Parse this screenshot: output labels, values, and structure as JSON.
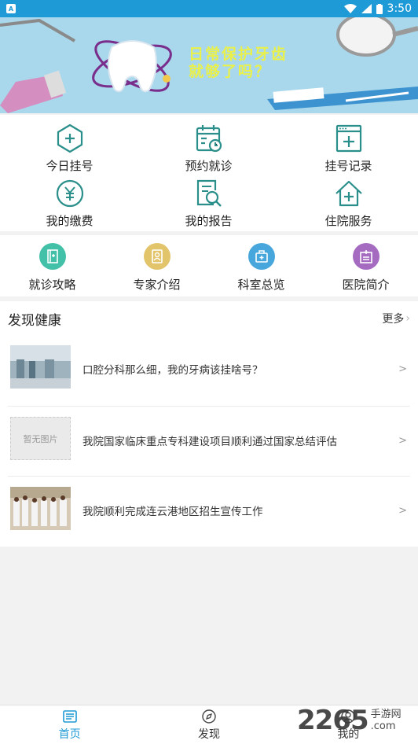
{
  "status_bar": {
    "time": "3:50",
    "app_icon": "A"
  },
  "banner": {
    "line1": "日常保护牙齿",
    "line2": "就够了吗？"
  },
  "main_grid": [
    {
      "label": "今日挂号",
      "icon": "plus-hex-icon"
    },
    {
      "label": "预约就诊",
      "icon": "calendar-clock-icon"
    },
    {
      "label": "挂号记录",
      "icon": "browser-plus-icon"
    },
    {
      "label": "我的缴费",
      "icon": "yuan-coin-icon"
    },
    {
      "label": "我的报告",
      "icon": "report-search-icon"
    },
    {
      "label": "住院服务",
      "icon": "house-plus-icon"
    }
  ],
  "secondary_grid": [
    {
      "label": "就诊攻略",
      "icon": "guide-book-icon",
      "color": "#43c0a8"
    },
    {
      "label": "专家介绍",
      "icon": "doctor-badge-icon",
      "color": "#e2c46a"
    },
    {
      "label": "科室总览",
      "icon": "medical-kit-icon",
      "color": "#47a7dc"
    },
    {
      "label": "医院简介",
      "icon": "hospital-icon",
      "color": "#a46bc0"
    }
  ],
  "discover": {
    "title": "发现健康",
    "more": "更多",
    "items": [
      {
        "title": "口腔分科那么细，我的牙病该挂啥号？",
        "thumb": "photo"
      },
      {
        "title": "我院国家临床重点专科建设项目顺利通过国家总结评估",
        "thumb": "placeholder",
        "placeholder_text": "暂无图片"
      },
      {
        "title": "我院顺利完成连云港地区招生宣传工作",
        "thumb": "photo"
      }
    ]
  },
  "bottom_nav": [
    {
      "label": "首页",
      "active": true
    },
    {
      "label": "发现",
      "active": false
    },
    {
      "label": "我的",
      "active": false
    }
  ],
  "watermark": {
    "number": "2265",
    "line1": "手游网",
    "line2": ".com"
  },
  "colors": {
    "primary": "#1e9ad6",
    "icon_teal": "#2a8f8a"
  }
}
